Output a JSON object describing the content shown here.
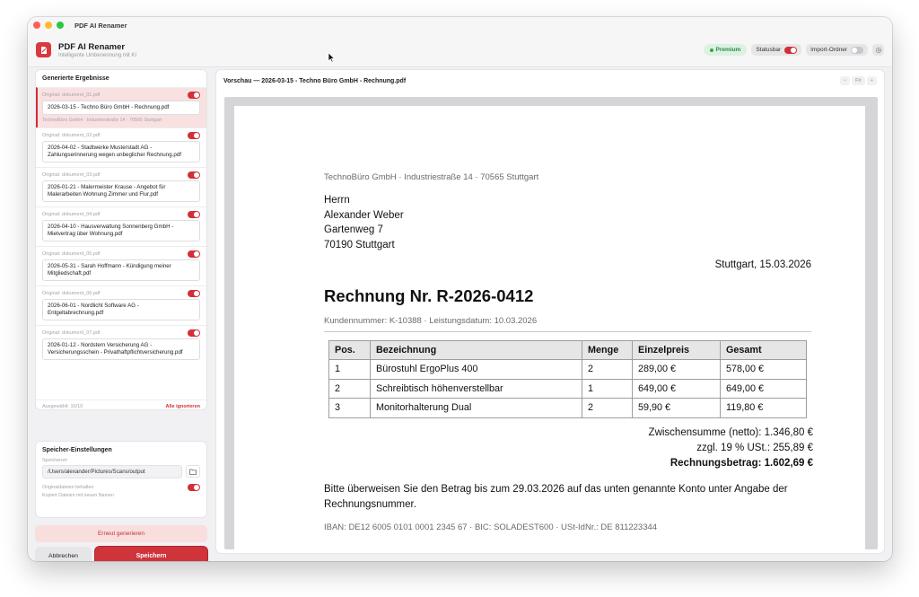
{
  "window": {
    "title": "PDF AI Renamer"
  },
  "app": {
    "name": "PDF AI Renamer",
    "subtitle": "Intelligente Umbenennung mit KI"
  },
  "header": {
    "premium_label": "Premium",
    "statusbar_label": "Statusbar",
    "statusbar_on": true,
    "import_label": "Import-Ordner",
    "import_on": false
  },
  "results": {
    "title": "Generierte Ergebnisse",
    "items": [
      {
        "original": "Original: dokument_01.pdf",
        "name": "2026-03-15 - Techno Büro GmbH - Rechnung.pdf",
        "address": "TechnoBüro GmbH · Industriestraße 14 · 70565 Stuttgart",
        "enabled": true,
        "selected": true
      },
      {
        "original": "Original: dokument_02.pdf",
        "name": "2026-04-02 - Stadtwerke Musterstadt AG - Zahlungserinnerung wegen unbeglicher Rechnung.pdf",
        "enabled": true
      },
      {
        "original": "Original: dokument_03.pdf",
        "name": "2026-01-21 - Malermeister Krause - Angebot für Malerarbeiten Wohnung Zimmer und Flur.pdf",
        "enabled": true
      },
      {
        "original": "Original: dokument_04.pdf",
        "name": "2026-04-10 - Hausverwaltung Sonnenberg GmbH - Mietvertrag über Wohnung.pdf",
        "enabled": true
      },
      {
        "original": "Original: dokument_05.pdf",
        "name": "2026-05-31 - Sarah Hoffmann - Kündigung meiner Mitgliedschaft.pdf",
        "enabled": true
      },
      {
        "original": "Original: dokument_06.pdf",
        "name": "2026-06-01 - Nordlicht Software AG - Entgeltabrechnung.pdf",
        "enabled": true
      },
      {
        "original": "Original: dokument_07.pdf",
        "name": "2026-01-12 - Nordstern Versicherung AG - Versicherungsschein - Privathaftpflichtversicherung.pdf",
        "enabled": true
      }
    ],
    "selected_count": "Ausgewählt: 10/10",
    "ignore_all": "Alle ignorieren"
  },
  "storage": {
    "title": "Speicher-Einstellungen",
    "location_label": "Speicherort:",
    "path": "/Users/alexander/Pictures/Scans/output",
    "keep_originals_label": "Originaldateien behalten",
    "keep_originals_note": "Kopiert Dateien mit neuen Namen",
    "keep_originals_on": true
  },
  "actions": {
    "regenerate": "Erneut generieren",
    "cancel": "Abbrechen",
    "save": "Speichern"
  },
  "preview": {
    "title": "Vorschau — 2026-03-15 - Techno Büro GmbH - Rechnung.pdf",
    "zoom_out": "−",
    "fit": "Fit",
    "zoom_in": "+"
  },
  "document": {
    "sender": "TechnoBüro GmbH · Industriestraße 14 · 70565 Stuttgart",
    "recipient": [
      "Herrn",
      "Alexander Weber",
      "Gartenweg 7",
      "70190 Stuttgart"
    ],
    "date": "Stuttgart, 15.03.2026",
    "title": "Rechnung Nr. R-2026-0412",
    "meta": "Kundennummer: K-10388 · Leistungsdatum: 10.03.2026",
    "table": {
      "headers": [
        "Pos.",
        "Bezeichnung",
        "Menge",
        "Einzelpreis",
        "Gesamt"
      ],
      "rows": [
        [
          "1",
          "Bürostuhl ErgoPlus 400",
          "2",
          "289,00 €",
          "578,00 €"
        ],
        [
          "2",
          "Schreibtisch höhenverstellbar",
          "1",
          "649,00 €",
          "649,00 €"
        ],
        [
          "3",
          "Monitorhalterung Dual",
          "2",
          "59,90 €",
          "119,80 €"
        ]
      ]
    },
    "subtotal": "Zwischensumme (netto): 1.346,80 €",
    "vat": "zzgl. 19 % USt.: 255,89 €",
    "total": "Rechnungsbetrag: 1.602,69 €",
    "payment_text": "Bitte überweisen Sie den Betrag bis zum 29.03.2026 auf das unten genannte Konto unter Angabe der Rechnungsnummer.",
    "bank": "IBAN: DE12 6005 0101 0001 2345 67 · BIC: SOLADEST600 · USt-IdNr.: DE 811223344"
  }
}
